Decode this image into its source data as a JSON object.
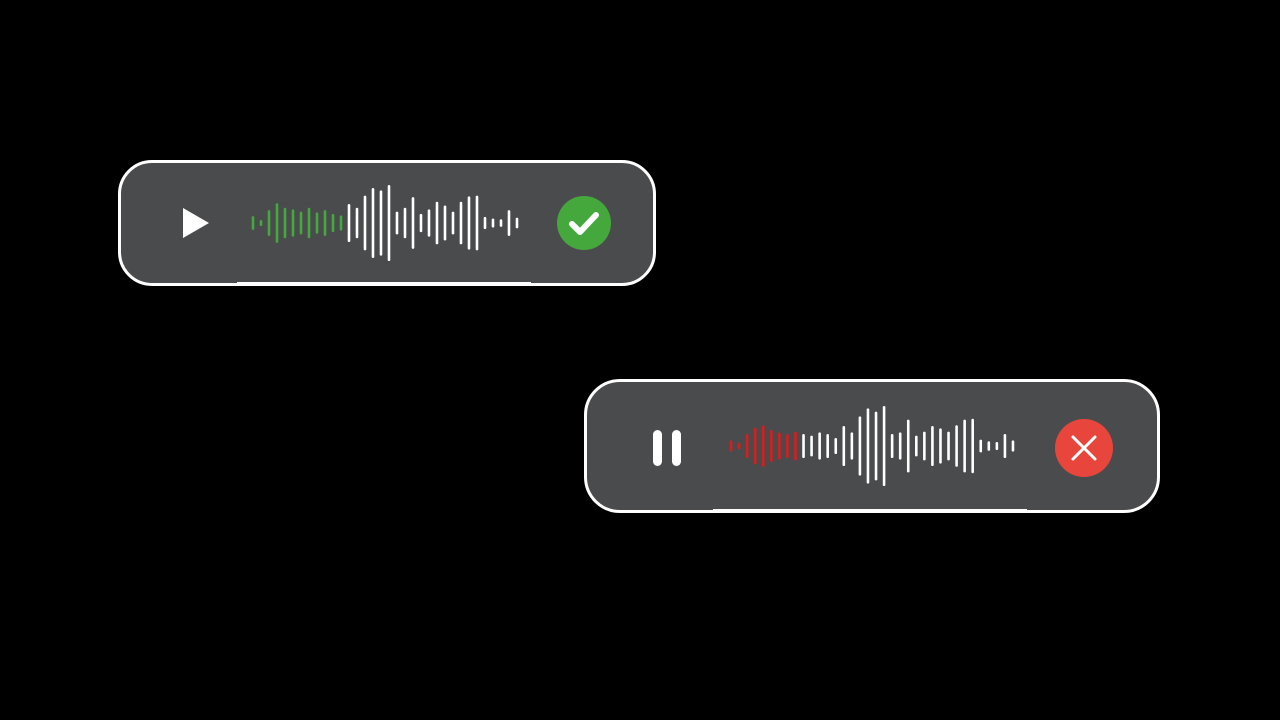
{
  "colors": {
    "background": "#000000",
    "panel": "#4a4b4d",
    "border": "#ffffff",
    "wave_unplayed": "#ffffff",
    "success": "#45a83d",
    "error": "#e8453c"
  },
  "players": [
    {
      "state": "stopped",
      "control_icon": "play-icon",
      "status_icon": "checkmark-icon",
      "status_color": "#45a83d",
      "wave_played_color": "#45a83d",
      "played_fraction": 0.34,
      "amplitudes": [
        0.18,
        0.08,
        0.34,
        0.52,
        0.4,
        0.36,
        0.3,
        0.4,
        0.28,
        0.34,
        0.24,
        0.2,
        0.5,
        0.4,
        0.72,
        0.92,
        0.86,
        1.0,
        0.3,
        0.4,
        0.68,
        0.24,
        0.36,
        0.56,
        0.46,
        0.3,
        0.56,
        0.7,
        0.72,
        0.16,
        0.12,
        0.1,
        0.34,
        0.14
      ]
    },
    {
      "state": "playing",
      "control_icon": "pause-icon",
      "status_icon": "close-icon",
      "status_color": "#e8453c",
      "wave_played_color": "#d91c1c",
      "played_fraction": 0.26,
      "amplitudes": [
        0.14,
        0.08,
        0.3,
        0.46,
        0.52,
        0.4,
        0.34,
        0.3,
        0.36,
        0.3,
        0.26,
        0.34,
        0.3,
        0.2,
        0.5,
        0.34,
        0.74,
        0.94,
        0.86,
        1.0,
        0.3,
        0.34,
        0.66,
        0.26,
        0.36,
        0.5,
        0.44,
        0.36,
        0.52,
        0.66,
        0.68,
        0.16,
        0.12,
        0.1,
        0.3,
        0.14
      ]
    }
  ]
}
